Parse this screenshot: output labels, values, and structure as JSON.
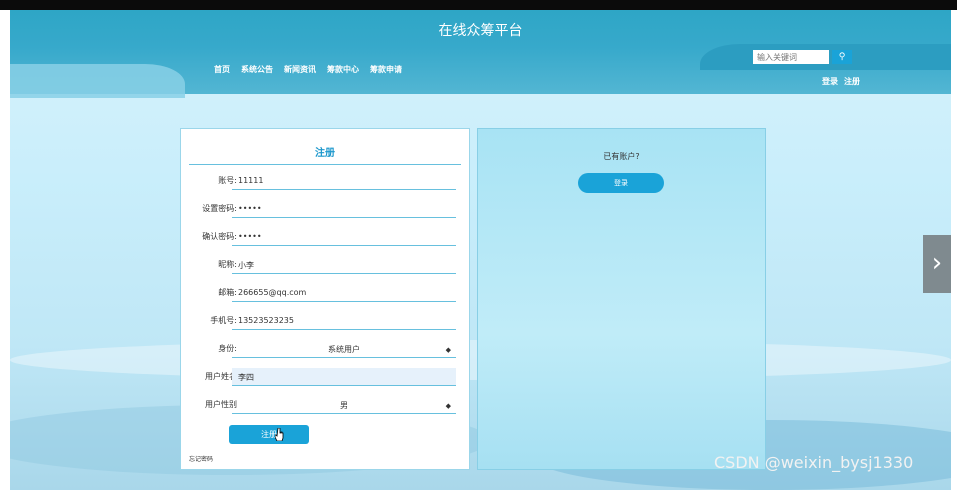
{
  "header": {
    "title": "在线众筹平台",
    "nav": [
      "首页",
      "系统公告",
      "新闻资讯",
      "筹款中心",
      "筹款申请"
    ],
    "search": {
      "placeholder": "输入关键词"
    },
    "auth": {
      "login": "登录",
      "register": "注册"
    }
  },
  "form": {
    "title": "注册",
    "fields": [
      {
        "label": "账号:",
        "value": "11111"
      },
      {
        "label": "设置密码:",
        "value": "•••••"
      },
      {
        "label": "确认密码:",
        "value": "•••••"
      },
      {
        "label": "昵称:",
        "value": "小李"
      },
      {
        "label": "邮箱:",
        "value": "266655@qq.com"
      },
      {
        "label": "手机号:",
        "value": "13523523235"
      },
      {
        "label": "身份:",
        "value": "系统用户"
      },
      {
        "label": "用户姓名",
        "value": "李四"
      },
      {
        "label": "用户性别",
        "value": "男"
      }
    ],
    "submit": "注册",
    "forgot": "忘记密码"
  },
  "side": {
    "prompt": "已有账户?",
    "login_button": "登录"
  },
  "watermark": "CSDN @weixin_bysj1330",
  "colors": {
    "accent": "#1aa3d8",
    "header": "#37a9cb"
  }
}
